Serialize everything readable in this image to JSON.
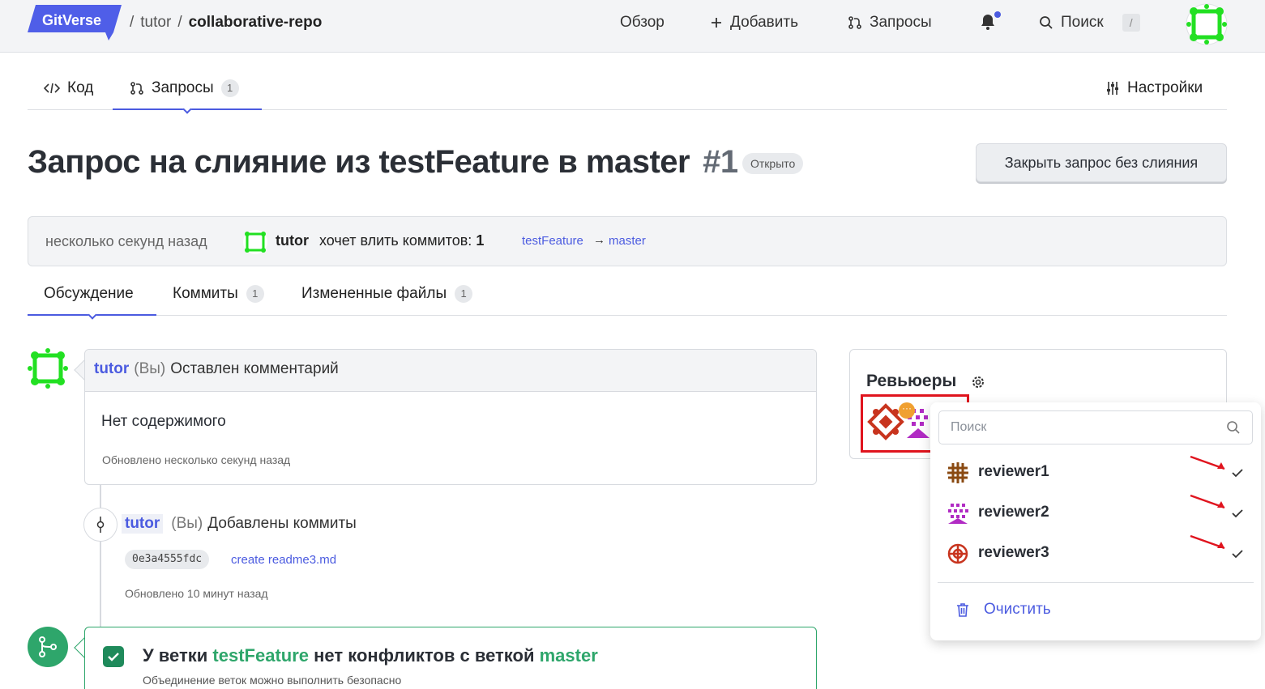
{
  "header": {
    "logo_text": "GitVerse",
    "breadcrumb": {
      "sep": "/",
      "owner": "tutor",
      "repo": "collaborative-repo"
    },
    "nav": {
      "overview": "Обзор",
      "add": "Добавить",
      "requests": "Запросы",
      "search": "Поиск",
      "search_shortcut": "/"
    }
  },
  "repo_tabs": {
    "code": "Код",
    "requests": "Запросы",
    "requests_count": "1",
    "settings": "Настройки"
  },
  "pr": {
    "title": "Запрос на слияние из testFeature в master",
    "number": "#1",
    "status": "Открыто",
    "close_button": "Закрыть запрос без слияния",
    "info": {
      "time": "несколько секунд назад",
      "user": "tutor",
      "wants": "хочет влить коммитов:",
      "commit_count": "1",
      "from_branch": "testFeature",
      "arrow": "→",
      "to_branch": "master"
    }
  },
  "pr_tabs": {
    "discussion": "Обсуждение",
    "commits": "Коммиты",
    "commits_count": "1",
    "files": "Измененные файлы",
    "files_count": "1"
  },
  "timeline": {
    "comment": {
      "user": "tutor",
      "you": "(Вы)",
      "action": "Оставлен комментарий",
      "body": "Нет содержимого",
      "updated": "Обновлено несколько секунд назад"
    },
    "commits_event": {
      "user": "tutor",
      "you": "(Вы)",
      "action": "Добавлены коммиты",
      "sha": "0e3a4555fdc",
      "message": "create readme3.md",
      "updated": "Обновлено 10 минут назад"
    },
    "merge": {
      "prefix": "У ветки",
      "branch_from": "testFeature",
      "middle": "нет конфликтов с веткой",
      "branch_to": "master",
      "subtitle": "Объединение веток можно выполнить безопасно"
    }
  },
  "reviewers": {
    "title": "Ревьюеры",
    "more_badge": "···",
    "search_placeholder": "Поиск",
    "items": [
      {
        "name": "reviewer1",
        "selected": true
      },
      {
        "name": "reviewer2",
        "selected": true
      },
      {
        "name": "reviewer3",
        "selected": true
      }
    ],
    "clear": "Очистить"
  },
  "colors": {
    "accent": "#4b5be0",
    "success": "#2ea66b",
    "annotation": "#e0141e"
  }
}
